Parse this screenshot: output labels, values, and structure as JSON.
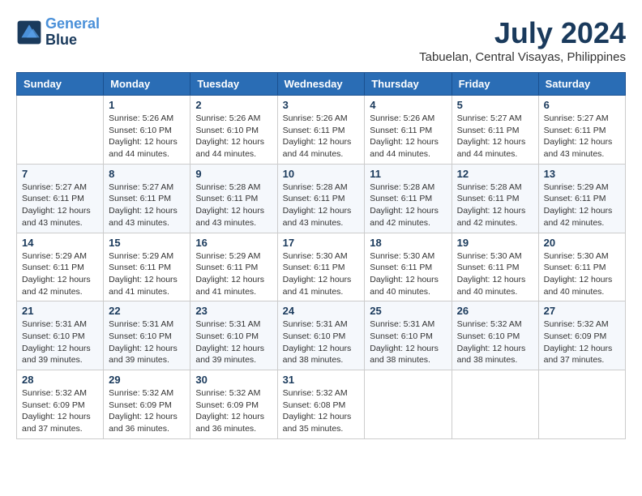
{
  "header": {
    "logo_line1": "General",
    "logo_line2": "Blue",
    "month": "July 2024",
    "location": "Tabuelan, Central Visayas, Philippines"
  },
  "weekdays": [
    "Sunday",
    "Monday",
    "Tuesday",
    "Wednesday",
    "Thursday",
    "Friday",
    "Saturday"
  ],
  "weeks": [
    [
      {
        "day": "",
        "info": ""
      },
      {
        "day": "1",
        "info": "Sunrise: 5:26 AM\nSunset: 6:10 PM\nDaylight: 12 hours\nand 44 minutes."
      },
      {
        "day": "2",
        "info": "Sunrise: 5:26 AM\nSunset: 6:10 PM\nDaylight: 12 hours\nand 44 minutes."
      },
      {
        "day": "3",
        "info": "Sunrise: 5:26 AM\nSunset: 6:11 PM\nDaylight: 12 hours\nand 44 minutes."
      },
      {
        "day": "4",
        "info": "Sunrise: 5:26 AM\nSunset: 6:11 PM\nDaylight: 12 hours\nand 44 minutes."
      },
      {
        "day": "5",
        "info": "Sunrise: 5:27 AM\nSunset: 6:11 PM\nDaylight: 12 hours\nand 44 minutes."
      },
      {
        "day": "6",
        "info": "Sunrise: 5:27 AM\nSunset: 6:11 PM\nDaylight: 12 hours\nand 43 minutes."
      }
    ],
    [
      {
        "day": "7",
        "info": "Sunrise: 5:27 AM\nSunset: 6:11 PM\nDaylight: 12 hours\nand 43 minutes."
      },
      {
        "day": "8",
        "info": "Sunrise: 5:27 AM\nSunset: 6:11 PM\nDaylight: 12 hours\nand 43 minutes."
      },
      {
        "day": "9",
        "info": "Sunrise: 5:28 AM\nSunset: 6:11 PM\nDaylight: 12 hours\nand 43 minutes."
      },
      {
        "day": "10",
        "info": "Sunrise: 5:28 AM\nSunset: 6:11 PM\nDaylight: 12 hours\nand 43 minutes."
      },
      {
        "day": "11",
        "info": "Sunrise: 5:28 AM\nSunset: 6:11 PM\nDaylight: 12 hours\nand 42 minutes."
      },
      {
        "day": "12",
        "info": "Sunrise: 5:28 AM\nSunset: 6:11 PM\nDaylight: 12 hours\nand 42 minutes."
      },
      {
        "day": "13",
        "info": "Sunrise: 5:29 AM\nSunset: 6:11 PM\nDaylight: 12 hours\nand 42 minutes."
      }
    ],
    [
      {
        "day": "14",
        "info": "Sunrise: 5:29 AM\nSunset: 6:11 PM\nDaylight: 12 hours\nand 42 minutes."
      },
      {
        "day": "15",
        "info": "Sunrise: 5:29 AM\nSunset: 6:11 PM\nDaylight: 12 hours\nand 41 minutes."
      },
      {
        "day": "16",
        "info": "Sunrise: 5:29 AM\nSunset: 6:11 PM\nDaylight: 12 hours\nand 41 minutes."
      },
      {
        "day": "17",
        "info": "Sunrise: 5:30 AM\nSunset: 6:11 PM\nDaylight: 12 hours\nand 41 minutes."
      },
      {
        "day": "18",
        "info": "Sunrise: 5:30 AM\nSunset: 6:11 PM\nDaylight: 12 hours\nand 40 minutes."
      },
      {
        "day": "19",
        "info": "Sunrise: 5:30 AM\nSunset: 6:11 PM\nDaylight: 12 hours\nand 40 minutes."
      },
      {
        "day": "20",
        "info": "Sunrise: 5:30 AM\nSunset: 6:11 PM\nDaylight: 12 hours\nand 40 minutes."
      }
    ],
    [
      {
        "day": "21",
        "info": "Sunrise: 5:31 AM\nSunset: 6:10 PM\nDaylight: 12 hours\nand 39 minutes."
      },
      {
        "day": "22",
        "info": "Sunrise: 5:31 AM\nSunset: 6:10 PM\nDaylight: 12 hours\nand 39 minutes."
      },
      {
        "day": "23",
        "info": "Sunrise: 5:31 AM\nSunset: 6:10 PM\nDaylight: 12 hours\nand 39 minutes."
      },
      {
        "day": "24",
        "info": "Sunrise: 5:31 AM\nSunset: 6:10 PM\nDaylight: 12 hours\nand 38 minutes."
      },
      {
        "day": "25",
        "info": "Sunrise: 5:31 AM\nSunset: 6:10 PM\nDaylight: 12 hours\nand 38 minutes."
      },
      {
        "day": "26",
        "info": "Sunrise: 5:32 AM\nSunset: 6:10 PM\nDaylight: 12 hours\nand 38 minutes."
      },
      {
        "day": "27",
        "info": "Sunrise: 5:32 AM\nSunset: 6:09 PM\nDaylight: 12 hours\nand 37 minutes."
      }
    ],
    [
      {
        "day": "28",
        "info": "Sunrise: 5:32 AM\nSunset: 6:09 PM\nDaylight: 12 hours\nand 37 minutes."
      },
      {
        "day": "29",
        "info": "Sunrise: 5:32 AM\nSunset: 6:09 PM\nDaylight: 12 hours\nand 36 minutes."
      },
      {
        "day": "30",
        "info": "Sunrise: 5:32 AM\nSunset: 6:09 PM\nDaylight: 12 hours\nand 36 minutes."
      },
      {
        "day": "31",
        "info": "Sunrise: 5:32 AM\nSunset: 6:08 PM\nDaylight: 12 hours\nand 35 minutes."
      },
      {
        "day": "",
        "info": ""
      },
      {
        "day": "",
        "info": ""
      },
      {
        "day": "",
        "info": ""
      }
    ]
  ]
}
